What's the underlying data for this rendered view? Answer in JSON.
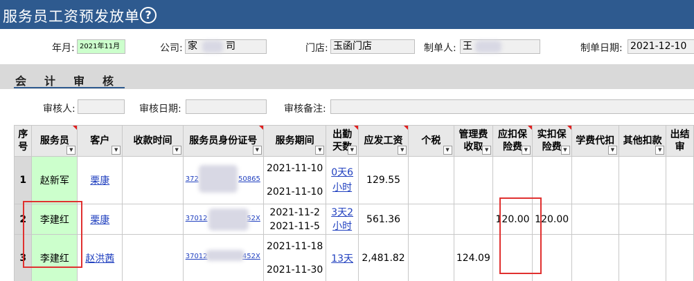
{
  "title": "服务员工资预发放单",
  "help_icon": "?",
  "form": {
    "year_month_label": "年月:",
    "year_month_value": "2021年11月",
    "company_label": "公司:",
    "company_value": "家",
    "company_value_tail": "司",
    "store_label": "门店:",
    "store_value": "玉函门店",
    "creator_label": "制单人:",
    "creator_value": "王",
    "date_label": "制单日期:",
    "date_value": "2021-12-10"
  },
  "audit": {
    "section_title": "会计审核",
    "auditor_label": "审核人:",
    "auditor_value": "",
    "audit_date_label": "审核日期:",
    "audit_date_value": "",
    "remark_label": "审核备注:",
    "remark_value": ""
  },
  "table": {
    "headers": [
      {
        "l1": "序",
        "l2": "号"
      },
      {
        "l1": "服务员",
        "l2": ""
      },
      {
        "l1": "客户",
        "l2": ""
      },
      {
        "l1": "收款时间",
        "l2": ""
      },
      {
        "l1": "服务员身份证号",
        "l2": ""
      },
      {
        "l1": "服务期间",
        "l2": ""
      },
      {
        "l1": "出勤",
        "l2": "天数"
      },
      {
        "l1": "应发工资",
        "l2": ""
      },
      {
        "l1": "个税",
        "l2": ""
      },
      {
        "l1": "管理费",
        "l2": "收取"
      },
      {
        "l1": "应扣保",
        "l2": "险费"
      },
      {
        "l1": "实扣保",
        "l2": "险费"
      },
      {
        "l1": "学费代扣",
        "l2": ""
      },
      {
        "l1": "其他扣款",
        "l2": ""
      },
      {
        "l1": "出结",
        "l2": "审"
      }
    ],
    "rows": [
      {
        "seq": "1",
        "employee": "赵新军",
        "customer": "栗康",
        "pay_time": "",
        "id_head": "372",
        "id_tail": "50865",
        "period_start": "2021-11-10",
        "period_end": "2021-11-10",
        "attendance_l1": "0天6",
        "attendance_l2": "小时",
        "gross": "129.55",
        "tax": "",
        "mgmt_fee": "",
        "ins_due": "",
        "ins_actual": "",
        "tuition": "",
        "other": "",
        "last": ""
      },
      {
        "seq": "2",
        "employee": "李建红",
        "customer": "栗康",
        "pay_time": "",
        "id_head": "37012",
        "id_tail": "52X",
        "period_start": "2021-11-2",
        "period_end": "2021-11-5",
        "attendance_l1": "3天2",
        "attendance_l2": "小时",
        "gross": "561.36",
        "tax": "",
        "mgmt_fee": "",
        "ins_due": "120.00",
        "ins_actual": "120.00",
        "tuition": "",
        "other": "",
        "last": ""
      },
      {
        "seq": "3",
        "employee": "李建红",
        "customer": "赵洪茜",
        "pay_time": "",
        "id_head": "37012",
        "id_tail": "452X",
        "period_start": "2021-11-18",
        "period_end": "2021-11-30",
        "attendance_l1": "13天",
        "attendance_l2": "",
        "gross": "2,481.82",
        "tax": "",
        "mgmt_fee": "124.09",
        "ins_due": "",
        "ins_actual": "",
        "tuition": "",
        "other": "",
        "last": ""
      }
    ]
  },
  "colors": {
    "title_bar": "#2e5a8f",
    "highlight": "#e0302f",
    "employee_bg": "#ccffcc",
    "link": "#1f3fbf"
  }
}
